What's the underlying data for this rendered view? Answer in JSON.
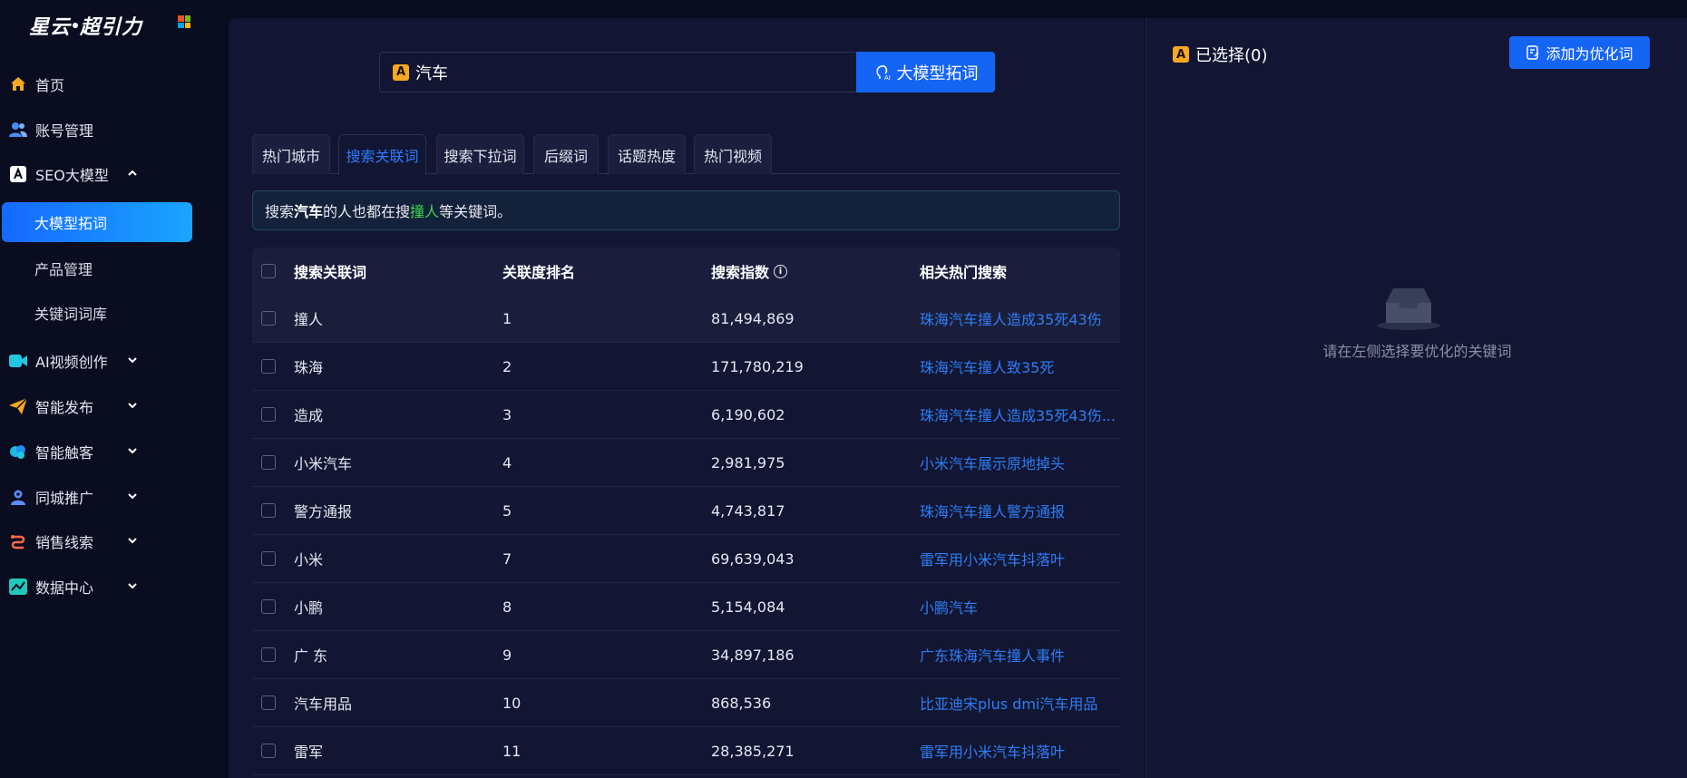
{
  "brand": {
    "logo_left": "星云",
    "logo_right": "超引力"
  },
  "sidebar": {
    "items": [
      {
        "label": "首页",
        "icon": "home-icon"
      },
      {
        "label": "账号管理",
        "icon": "users-icon"
      },
      {
        "label": "SEO大模型",
        "icon": "a-letter-icon",
        "expanded": true,
        "children": [
          {
            "label": "大模型拓词",
            "active": true
          },
          {
            "label": "产品管理"
          },
          {
            "label": "关键词词库"
          }
        ]
      },
      {
        "label": "AI视频创作",
        "icon": "video-icon"
      },
      {
        "label": "智能发布",
        "icon": "paper-plane-icon"
      },
      {
        "label": "智能触客",
        "icon": "cloud-icon"
      },
      {
        "label": "同城推广",
        "icon": "location-user-icon"
      },
      {
        "label": "销售线索",
        "icon": "route-icon"
      },
      {
        "label": "数据中心",
        "icon": "chart-icon"
      }
    ]
  },
  "search": {
    "value": "汽车",
    "button_label": "大模型拓词",
    "badge": "A"
  },
  "tabs": [
    "热门城市",
    "搜索关联词",
    "搜索下拉词",
    "后缀词",
    "话题热度",
    "热门视频"
  ],
  "active_tab": 1,
  "tip": {
    "prefix": "搜索",
    "keyword": "汽车",
    "middle": "的人也都在搜",
    "highlight": "撞人",
    "suffix": "等关键词。"
  },
  "table": {
    "headers": [
      "搜索关联词",
      "关联度排名",
      "搜索指数",
      "相关热门搜索"
    ],
    "info_icon": "i",
    "rows": [
      {
        "word": "撞人",
        "rank": "1",
        "index": "81,494,869",
        "related": "珠海汽车撞人造成35死43伤"
      },
      {
        "word": "珠海",
        "rank": "2",
        "index": "171,780,219",
        "related": "珠海汽车撞人致35死"
      },
      {
        "word": "造成",
        "rank": "3",
        "index": "6,190,602",
        "related": "珠海汽车撞人造成35死43伤..."
      },
      {
        "word": "小米汽车",
        "rank": "4",
        "index": "2,981,975",
        "related": "小米汽车展示原地掉头"
      },
      {
        "word": "警方通报",
        "rank": "5",
        "index": "4,743,817",
        "related": "珠海汽车撞人警方通报"
      },
      {
        "word": "小米",
        "rank": "7",
        "index": "69,639,043",
        "related": "雷军用小米汽车抖落叶"
      },
      {
        "word": "小鹏",
        "rank": "8",
        "index": "5,154,084",
        "related": "小鹏汽车"
      },
      {
        "word": "广 东",
        "rank": "9",
        "index": "34,897,186",
        "related": "广东珠海汽车撞人事件"
      },
      {
        "word": "汽车用品",
        "rank": "10",
        "index": "868,536",
        "related": "比亚迪宋plus dmi汽车用品"
      },
      {
        "word": "雷军",
        "rank": "11",
        "index": "28,385,271",
        "related": "雷军用小米汽车抖落叶"
      }
    ]
  },
  "right_panel": {
    "title": "已选择(0)",
    "badge": "A",
    "add_button": "添加为优化词",
    "empty_text": "请在左侧选择要优化的关键词"
  },
  "colors": {
    "accent": "#1565f5",
    "link": "#2f7df5",
    "highlight": "#3dd34d",
    "badge": "#f6a823"
  }
}
